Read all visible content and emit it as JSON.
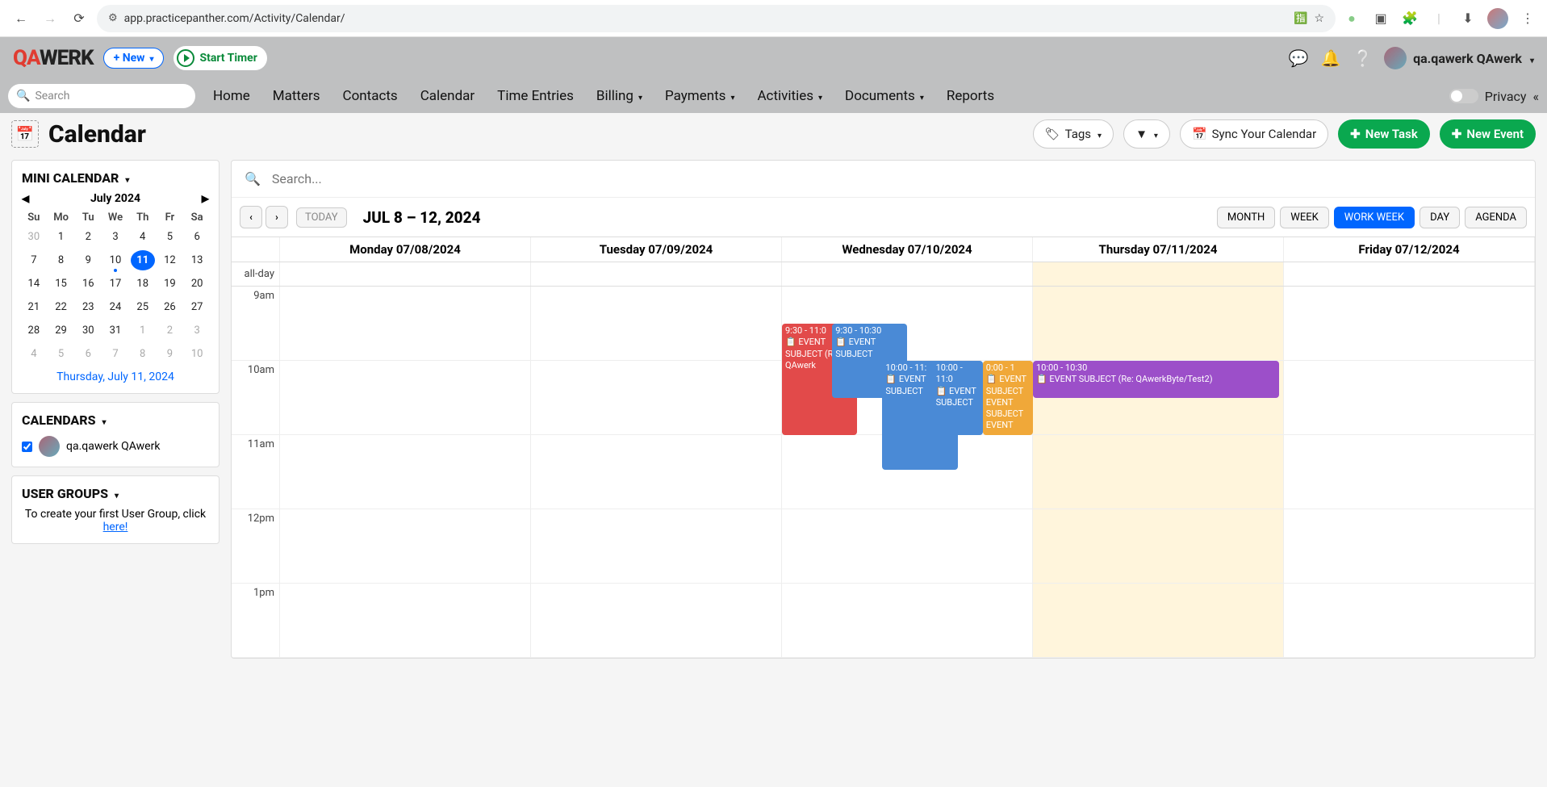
{
  "browser": {
    "url": "app.practicepanther.com/Activity/Calendar/"
  },
  "header": {
    "logo_qa": "QA",
    "logo_werk": "WERK",
    "new_btn": "+ New",
    "timer_btn": "Start Timer",
    "user_name": "qa.qawerk QAwerk"
  },
  "nav": {
    "search_placeholder": "Search",
    "links": [
      "Home",
      "Matters",
      "Contacts",
      "Calendar",
      "Time Entries",
      "Billing",
      "Payments",
      "Activities",
      "Documents",
      "Reports"
    ],
    "dropdowns": [
      false,
      false,
      false,
      false,
      false,
      true,
      true,
      true,
      true,
      false
    ],
    "privacy": "Privacy"
  },
  "page_header": {
    "title": "Calendar",
    "tags_btn": "Tags",
    "sync_btn": "Sync Your Calendar",
    "new_task": "New Task",
    "new_event": "New Event"
  },
  "sidebar": {
    "mini_title": "MINI CALENDAR",
    "month_label": "July 2024",
    "dow": [
      "Su",
      "Mo",
      "Tu",
      "We",
      "Th",
      "Fr",
      "Sa"
    ],
    "days": [
      {
        "d": "30",
        "other": true
      },
      {
        "d": "1"
      },
      {
        "d": "2"
      },
      {
        "d": "3"
      },
      {
        "d": "4"
      },
      {
        "d": "5"
      },
      {
        "d": "6"
      },
      {
        "d": "7"
      },
      {
        "d": "8"
      },
      {
        "d": "9"
      },
      {
        "d": "10",
        "dot": true
      },
      {
        "d": "11",
        "sel": true
      },
      {
        "d": "12"
      },
      {
        "d": "13"
      },
      {
        "d": "14"
      },
      {
        "d": "15"
      },
      {
        "d": "16"
      },
      {
        "d": "17"
      },
      {
        "d": "18"
      },
      {
        "d": "19"
      },
      {
        "d": "20"
      },
      {
        "d": "21"
      },
      {
        "d": "22"
      },
      {
        "d": "23"
      },
      {
        "d": "24"
      },
      {
        "d": "25"
      },
      {
        "d": "26"
      },
      {
        "d": "27"
      },
      {
        "d": "28"
      },
      {
        "d": "29"
      },
      {
        "d": "30"
      },
      {
        "d": "31"
      },
      {
        "d": "1",
        "other": true
      },
      {
        "d": "2",
        "other": true
      },
      {
        "d": "3",
        "other": true
      },
      {
        "d": "4",
        "other": true
      },
      {
        "d": "5",
        "other": true
      },
      {
        "d": "6",
        "other": true
      },
      {
        "d": "7",
        "other": true
      },
      {
        "d": "8",
        "other": true
      },
      {
        "d": "9",
        "other": true
      },
      {
        "d": "10",
        "other": true
      }
    ],
    "today_link": "Thursday, July 11, 2024",
    "calendars_title": "CALENDARS",
    "calendar_name": "qa.qawerk QAwerk",
    "ug_title": "USER GROUPS",
    "ug_text": "To create your first User Group, click ",
    "ug_link": "here!"
  },
  "calendar": {
    "search_placeholder": "Search...",
    "today_btn": "TODAY",
    "range": "JUL 8 – 12, 2024",
    "views": [
      "MONTH",
      "WEEK",
      "WORK WEEK",
      "DAY",
      "AGENDA"
    ],
    "active_view": 2,
    "day_headers": [
      "Monday 07/08/2024",
      "Tuesday 07/09/2024",
      "Wednesday 07/10/2024",
      "Thursday 07/11/2024",
      "Friday 07/12/2024"
    ],
    "today_col": 3,
    "allday_label": "all-day",
    "time_labels": [
      "9am",
      "10am",
      "11am",
      "12pm",
      "1pm"
    ],
    "events": {
      "wed_red": {
        "time": "9:30 - 11:0",
        "title": "📋 EVENT SUBJECT (Re: QAwerk"
      },
      "wed_blue1": {
        "time": "9:30 - 10:30",
        "title": "📋 EVENT SUBJECT"
      },
      "wed_blue2": {
        "time": "10:00 - 11:",
        "title": "📋 EVENT SUBJECT"
      },
      "wed_blue3": {
        "time": "10:00 - 11:0",
        "title": "📋 EVENT SUBJECT"
      },
      "wed_orange": {
        "time": "0:00 - 1",
        "title": "📋 EVENT SUBJECT EVENT SUBJECT EVENT"
      },
      "thu_purple": {
        "time": "10:00 - 10:30",
        "title": "📋 EVENT SUBJECT (Re: QAwerkByte/Test2)"
      }
    }
  }
}
